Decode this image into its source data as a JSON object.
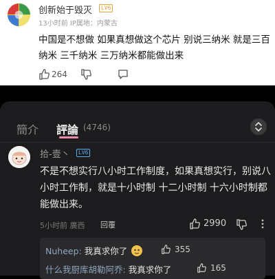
{
  "post": {
    "username": "创新始于毁灭",
    "level_badge": "LV6",
    "meta": "13小时前 IP属地：内蒙古",
    "text": "中国是不想做 如果真想做这个芯片 别说三纳米 就是三百纳米 三千纳米 三万纳米都能做出来",
    "likes": "264"
  },
  "panel": {
    "tab_intro": "簡介",
    "tab_comments": "評論",
    "comment_count": "(4746)"
  },
  "comment": {
    "username": "拾-壹丶",
    "level_badge": "LV6",
    "text": "不是不想实行八小时工作制度，如果真想实行，别说八小时工作制，就是十小时制 十二小时制 十六小时制都能做出来。",
    "meta": "5小时前 廣西",
    "reply_label": "回覆",
    "likes": "2990"
  },
  "replies": [
    {
      "user": "Nuheep",
      "sep": ": ",
      "text": "我真求你了",
      "likes": "355"
    },
    {
      "user": "什么我厨库胡勒阿乔",
      "sep": ": ",
      "text": "我真求你了",
      "likes": "165"
    }
  ],
  "colors": {
    "accent_pink": "#f08aa8",
    "reply_user": "#8fa7bf",
    "badge_orange": "#e0a23b",
    "badge_blue": "#5ab0e8"
  }
}
